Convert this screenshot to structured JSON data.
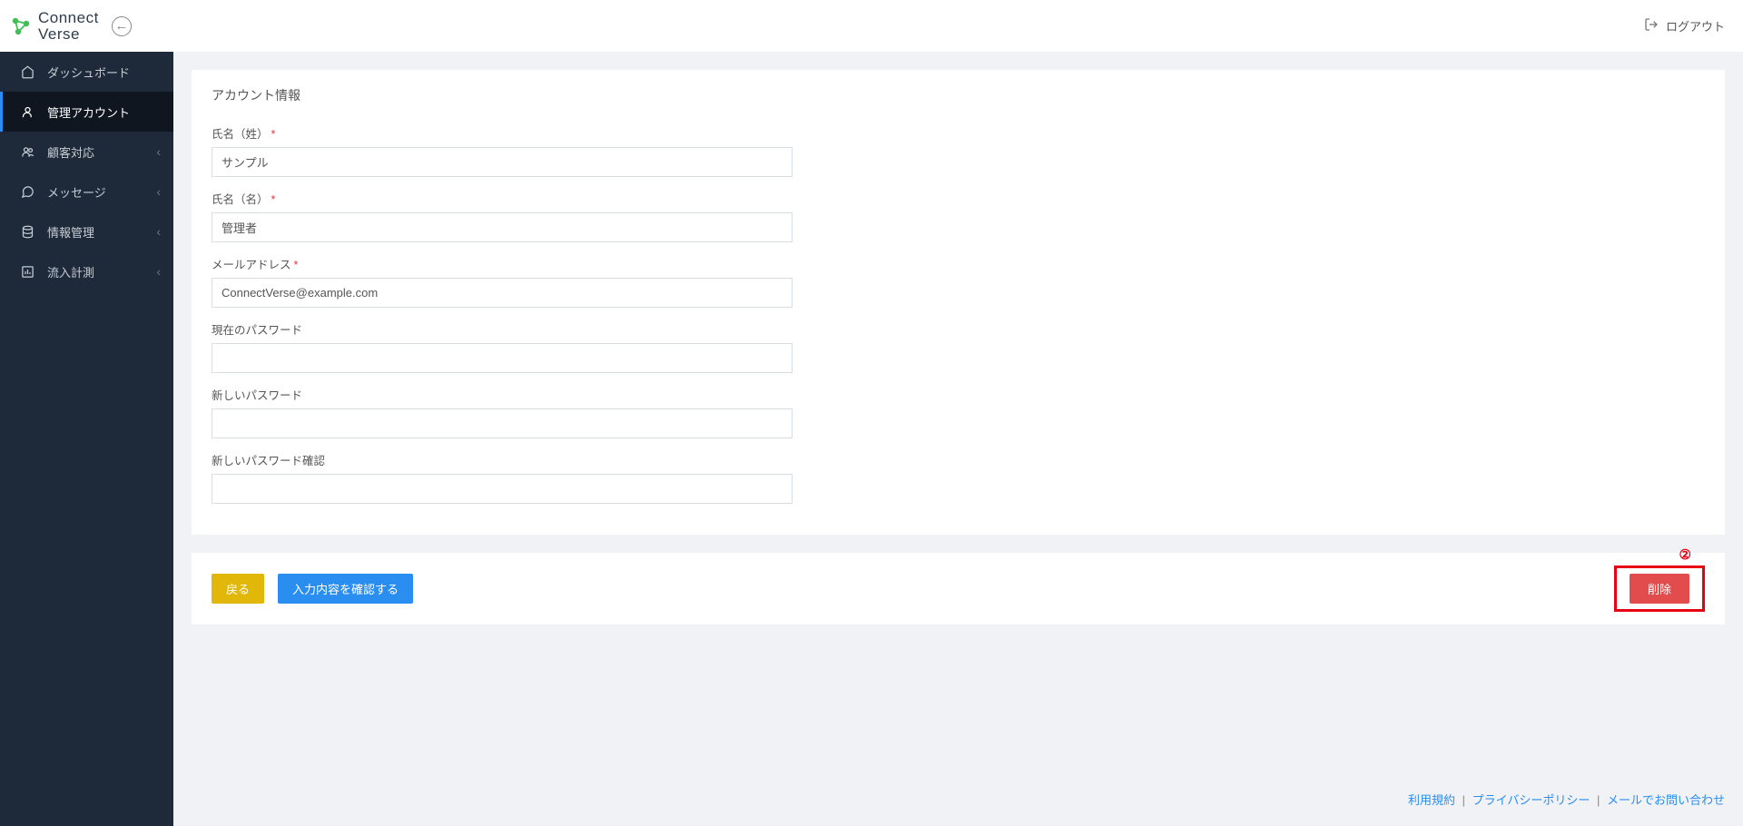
{
  "header": {
    "logo_line1": "Connect",
    "logo_line2": "Verse",
    "logout_label": "ログアウト"
  },
  "sidebar": {
    "items": [
      {
        "label": "ダッシュボード",
        "icon": "home",
        "expandable": false,
        "active": false
      },
      {
        "label": "管理アカウント",
        "icon": "user",
        "expandable": false,
        "active": true
      },
      {
        "label": "顧客対応",
        "icon": "users",
        "expandable": true,
        "active": false
      },
      {
        "label": "メッセージ",
        "icon": "chat",
        "expandable": true,
        "active": false
      },
      {
        "label": "情報管理",
        "icon": "db",
        "expandable": true,
        "active": false
      },
      {
        "label": "流入計測",
        "icon": "chart",
        "expandable": true,
        "active": false
      }
    ]
  },
  "main": {
    "card_title": "アカウント情報",
    "fields": {
      "last_name_label": "氏名（姓）",
      "last_name_value": "サンプル",
      "first_name_label": "氏名（名）",
      "first_name_value": "管理者",
      "email_label": "メールアドレス",
      "email_value": "ConnectVerse@example.com",
      "current_pw_label": "現在のパスワード",
      "current_pw_value": "",
      "new_pw_label": "新しいパスワード",
      "new_pw_value": "",
      "new_pw_confirm_label": "新しいパスワード確認",
      "new_pw_confirm_value": ""
    },
    "buttons": {
      "back": "戻る",
      "confirm": "入力内容を確認する",
      "delete": "削除"
    },
    "annotation": "②"
  },
  "footer": {
    "terms": "利用規約",
    "privacy": "プライバシーポリシー",
    "contact": "メールでお問い合わせ"
  }
}
